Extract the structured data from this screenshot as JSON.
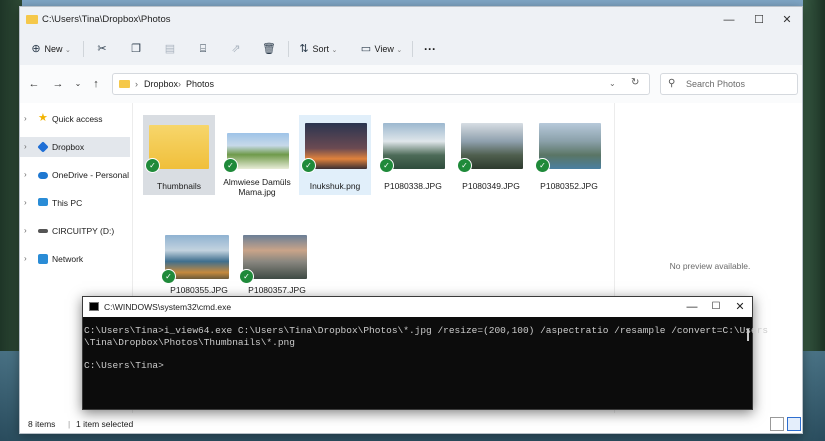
{
  "explorer": {
    "title": "C:\\Users\\Tina\\Dropbox\\Photos",
    "toolbar": {
      "new_label": "New",
      "sort_label": "Sort",
      "view_label": "View",
      "more_label": "···"
    },
    "breadcrumb": {
      "sep": "›",
      "items": [
        "Dropbox",
        "Photos"
      ]
    },
    "search_placeholder": "Search Photos",
    "sidebar": {
      "items": [
        {
          "label": "Quick access",
          "icon": "star-icon",
          "color": "#f2b300"
        },
        {
          "label": "Dropbox",
          "icon": "dropbox-icon",
          "color": "#1f6fd6",
          "selected": true
        },
        {
          "label": "OneDrive - Personal",
          "icon": "cloud-icon",
          "color": "#1f78d1"
        },
        {
          "label": "This PC",
          "icon": "pc-icon",
          "color": "#2a8cd6"
        },
        {
          "label": "CIRCUITPY (D:)",
          "icon": "drive-icon",
          "color": "#555555"
        },
        {
          "label": "Network",
          "icon": "network-icon",
          "color": "#2a8cd6"
        }
      ]
    },
    "files": [
      {
        "name": "Thumbnails",
        "type": "folder"
      },
      {
        "name": "Almwiese Damüls Mama.jpg",
        "type": "image"
      },
      {
        "name": "Inukshuk.png",
        "type": "image"
      },
      {
        "name": "P1080338.JPG",
        "type": "image"
      },
      {
        "name": "P1080349.JPG",
        "type": "image"
      },
      {
        "name": "P1080352.JPG",
        "type": "image"
      },
      {
        "name": "P1080355.JPG",
        "type": "image"
      },
      {
        "name": "P1080357.JPG",
        "type": "image"
      }
    ],
    "preview_text": "No preview available.",
    "status": {
      "items": "8 items",
      "selected": "1 item selected"
    }
  },
  "cmd": {
    "title": "C:\\WINDOWS\\system32\\cmd.exe",
    "lines": [
      "C:\\Users\\Tina>i_view64.exe C:\\Users\\Tina\\Dropbox\\Photos\\*.jpg /resize=(200,100) /aspectratio /resample /convert=C:\\Users",
      "\\Tina\\Dropbox\\Photos\\Thumbnails\\*.png",
      "",
      "C:\\Users\\Tina>"
    ]
  },
  "colors": {
    "sync_check": "#1f8a3a",
    "folder": "#f5c84a",
    "selection": "#d9dde2",
    "cmd_bg": "#0c0c0c",
    "cmd_text": "#cccccc"
  }
}
